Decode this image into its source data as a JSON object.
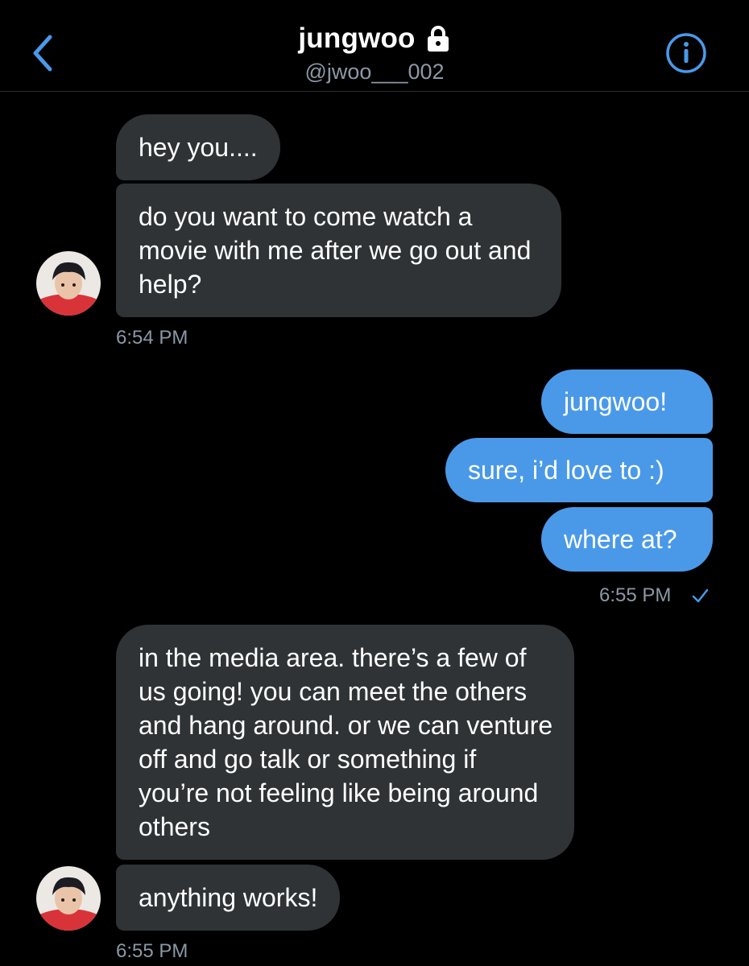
{
  "header": {
    "title": "jungwoo",
    "handle": "@jwoo___002",
    "back_icon": "chevron-left-icon",
    "lock_icon": "lock-icon",
    "info_icon": "info-icon"
  },
  "colors": {
    "accent": "#4a99e9",
    "incoming_bubble": "#2f3336",
    "secondary_text": "#8b98a5",
    "background": "#000000"
  },
  "messages": [
    {
      "direction": "incoming",
      "text": "hey you...."
    },
    {
      "direction": "incoming",
      "text": "do you want to come watch a movie with me after we go out and help?"
    },
    {
      "direction": "outgoing",
      "text": "jungwoo!"
    },
    {
      "direction": "outgoing",
      "text": "sure, i’d love to :)"
    },
    {
      "direction": "outgoing",
      "text": "where at?"
    },
    {
      "direction": "incoming",
      "text": "in the media area. there’s a few of us going! you can meet the others and hang around. or we can venture off and go talk or something if you’re not feeling like being around others"
    },
    {
      "direction": "incoming",
      "text": "anything works!"
    }
  ],
  "timestamps": {
    "group1": "6:54 PM",
    "group2": "6:55 PM",
    "group3": "6:55 PM"
  },
  "read_receipt_icon": "checkmark-icon"
}
